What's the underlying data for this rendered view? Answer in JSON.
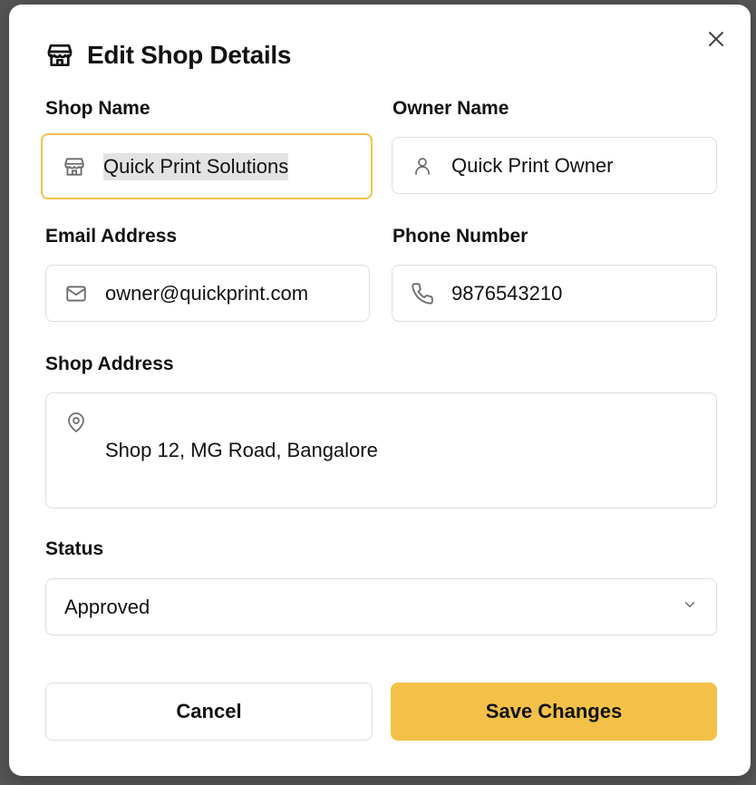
{
  "modal": {
    "title": "Edit Shop Details",
    "icons": {
      "title": "store-icon",
      "close": "close-icon"
    }
  },
  "form": {
    "shop_name": {
      "label": "Shop Name",
      "value": "Quick Print Solutions",
      "icon": "store-icon"
    },
    "owner_name": {
      "label": "Owner Name",
      "value": "Quick Print Owner",
      "icon": "user-icon"
    },
    "email": {
      "label": "Email Address",
      "value": "owner@quickprint.com",
      "icon": "mail-icon"
    },
    "phone": {
      "label": "Phone Number",
      "value": "9876543210",
      "icon": "phone-icon"
    },
    "address": {
      "label": "Shop Address",
      "value": "Shop 12, MG Road, Bangalore",
      "icon": "map-pin-icon"
    },
    "status": {
      "label": "Status",
      "value": "Approved",
      "icon": "chevron-down-icon"
    }
  },
  "actions": {
    "cancel_label": "Cancel",
    "save_label": "Save Changes"
  },
  "colors": {
    "accent": "#f3c147",
    "focus_border": "#f2c14a",
    "field_border": "#dedede",
    "text": "#111111",
    "icon": "#6b6b6b"
  }
}
